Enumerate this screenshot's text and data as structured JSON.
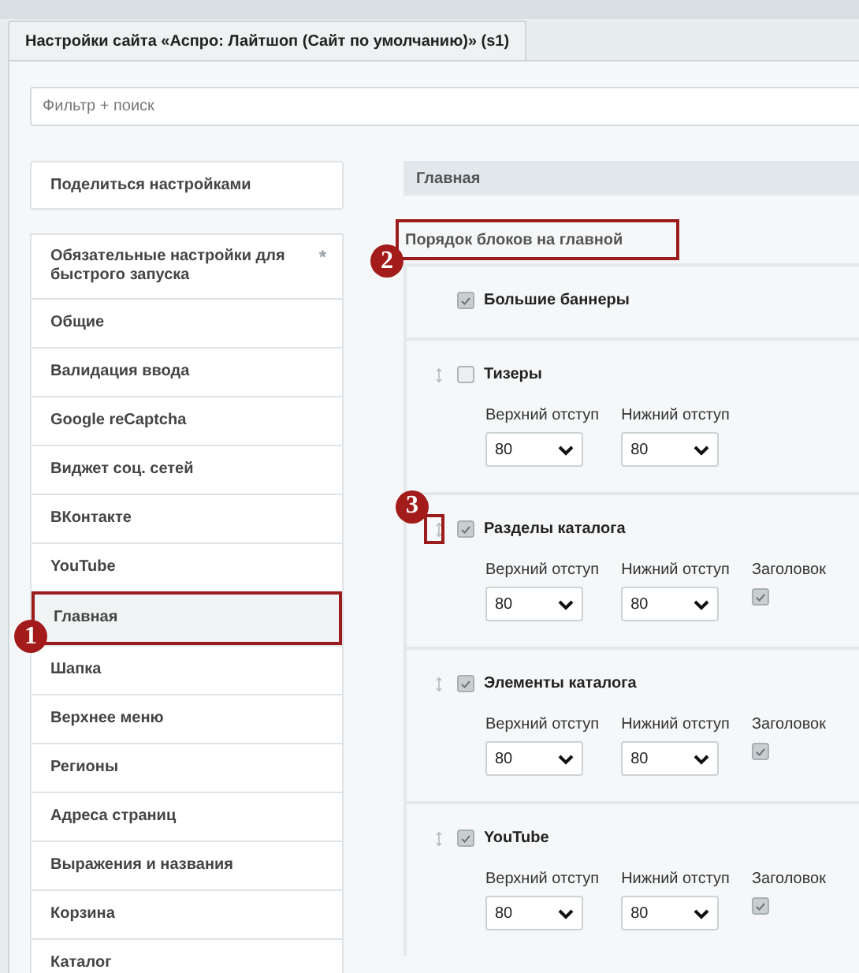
{
  "tabs": [
    {
      "label": "Настройки сайта «Аспро: Лайтшоп (Сайт по умолчанию)» (s1)",
      "selected": true
    }
  ],
  "search": {
    "placeholder": "Фильтр + поиск"
  },
  "share_button": "Поделиться настройками",
  "sidebar": {
    "items": [
      {
        "label": "Обязательные настройки для быстрого запуска",
        "selected": false,
        "mark": "*"
      },
      {
        "label": "Общие",
        "selected": false
      },
      {
        "label": "Валидация ввода",
        "selected": false
      },
      {
        "label": "Google reCaptcha",
        "selected": false
      },
      {
        "label": "Виджет соц. сетей",
        "selected": false
      },
      {
        "label": "ВКонтакте",
        "selected": false
      },
      {
        "label": "YouTube",
        "selected": false
      },
      {
        "label": "Главная",
        "selected": true,
        "callout": "1"
      },
      {
        "label": "Шапка",
        "selected": false
      },
      {
        "label": "Верхнее меню",
        "selected": false
      },
      {
        "label": "Регионы",
        "selected": false
      },
      {
        "label": "Адреса страниц",
        "selected": false
      },
      {
        "label": "Выражения и названия",
        "selected": false
      },
      {
        "label": "Корзина",
        "selected": false
      },
      {
        "label": "Каталог",
        "selected": false
      }
    ]
  },
  "panel": {
    "title": "Главная",
    "section": {
      "title": "Порядок блоков на главной",
      "callout": "2"
    },
    "blocks": [
      {
        "label": "Большие баннеры",
        "checked": true,
        "draggable": false
      },
      {
        "label": "Тизеры",
        "checked": false,
        "draggable": true,
        "fields": [
          {
            "label": "Верхний отступ",
            "value": "80"
          },
          {
            "label": "Нижний отступ",
            "value": "80"
          }
        ]
      },
      {
        "label": "Разделы каталога",
        "checked": true,
        "draggable": true,
        "callout": "3",
        "fields": [
          {
            "label": "Верхний отступ",
            "value": "80"
          },
          {
            "label": "Нижний отступ",
            "value": "80"
          }
        ],
        "header_option": {
          "label": "Заголовок",
          "checked": true
        }
      },
      {
        "label": "Элементы каталога",
        "checked": true,
        "draggable": true,
        "fields": [
          {
            "label": "Верхний отступ",
            "value": "80"
          },
          {
            "label": "Нижний отступ",
            "value": "80"
          }
        ],
        "header_option": {
          "label": "Заголовок",
          "checked": true
        }
      },
      {
        "label": "YouTube",
        "checked": true,
        "draggable": true,
        "fields": [
          {
            "label": "Верхний отступ",
            "value": "80"
          },
          {
            "label": "Нижний отступ",
            "value": "80"
          }
        ],
        "header_option": {
          "label": "Заголовок",
          "checked": true
        }
      }
    ]
  }
}
